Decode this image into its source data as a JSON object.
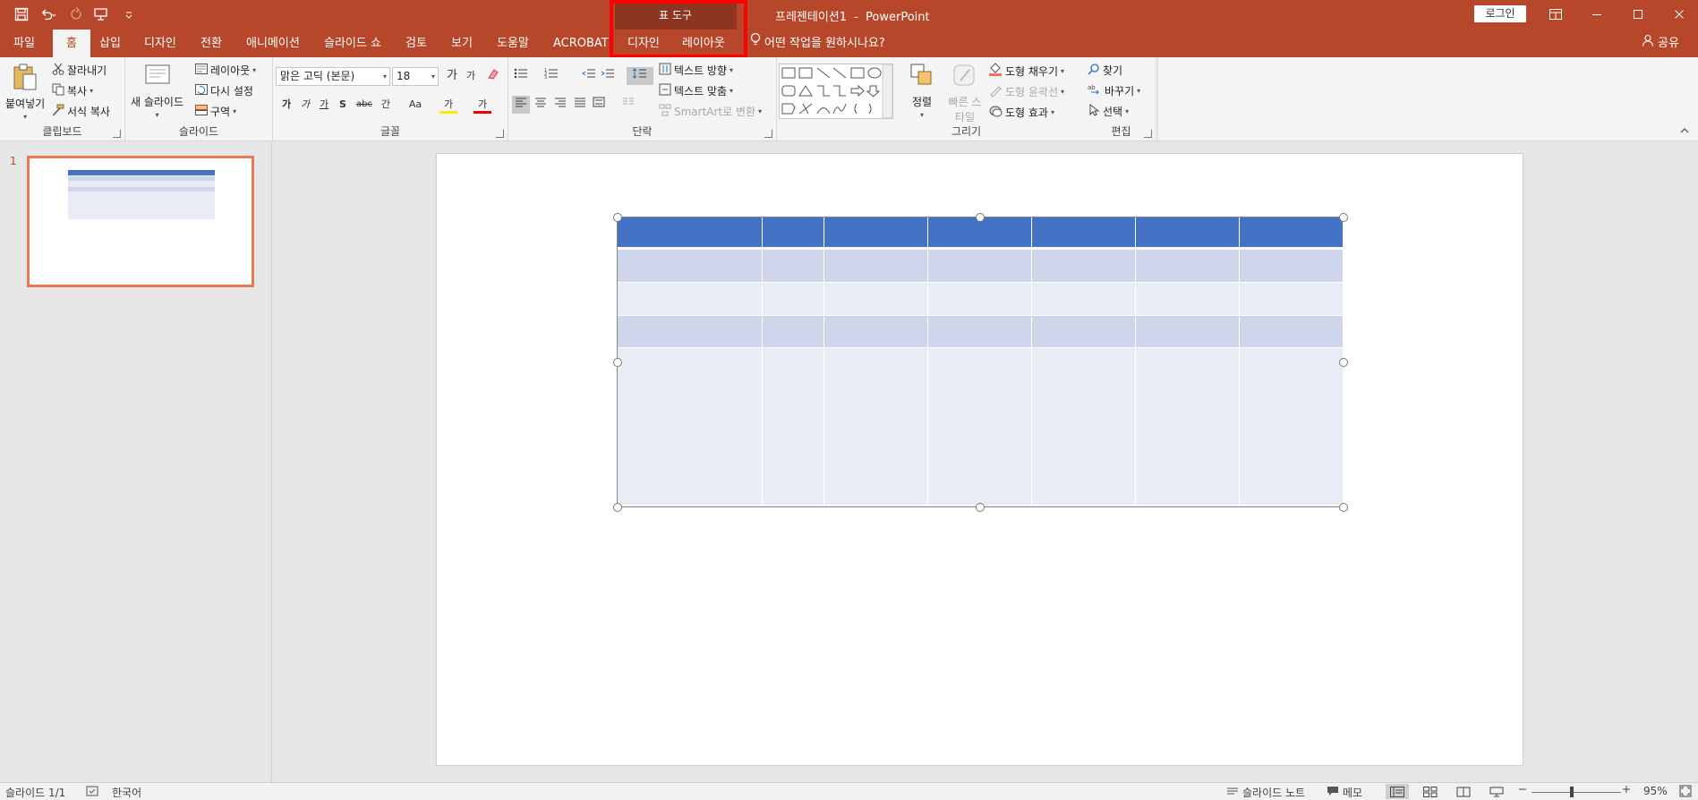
{
  "app": {
    "document_title": "프레젠테이션1",
    "separator": "-",
    "app_name": "PowerPoint",
    "login_label": "로그인",
    "context_group_label": "표 도구"
  },
  "tabs": [
    {
      "label": "파일"
    },
    {
      "label": "홈"
    },
    {
      "label": "삽입"
    },
    {
      "label": "디자인"
    },
    {
      "label": "전환"
    },
    {
      "label": "애니메이션"
    },
    {
      "label": "슬라이드 쇼"
    },
    {
      "label": "검토"
    },
    {
      "label": "보기"
    },
    {
      "label": "도움말"
    },
    {
      "label": "ACROBAT"
    },
    {
      "label": "디자인"
    },
    {
      "label": "레이아웃"
    }
  ],
  "active_tab_index": 1,
  "tellme": "어떤 작업을 원하시나요?",
  "share": "공유",
  "ribbon": {
    "clipboard": {
      "label": "클립보드",
      "paste": "붙여넣기",
      "cut": "잘라내기",
      "copy": "복사",
      "format_painter": "서식 복사"
    },
    "slides": {
      "label": "슬라이드",
      "new_slide": "새 슬라이드",
      "layout": "레이아웃",
      "reset": "다시 설정",
      "section": "구역"
    },
    "font": {
      "label": "글꼴",
      "font_name": "맑은 고딕 (본문)",
      "font_size": "18",
      "grow": "가",
      "shrink": "가",
      "bold": "가",
      "italic": "가",
      "underline": "가",
      "shadow": "S",
      "strike": "abc",
      "spacing": "간",
      "case": "Aa",
      "highlight": "가",
      "color": "가"
    },
    "paragraph": {
      "label": "단락",
      "text_direction": "텍스트 방향",
      "align_text": "텍스트 맞춤",
      "smartart": "SmartArt로 변환"
    },
    "drawing": {
      "label": "그리기",
      "arrange": "정렬",
      "quick_styles": "빠른 스타일",
      "fill": "도형 채우기",
      "outline": "도형 윤곽선",
      "effects": "도형 효과"
    },
    "editing": {
      "label": "편집",
      "find": "찾기",
      "replace": "바꾸기",
      "select": "선택"
    }
  },
  "slide_panel": {
    "slide_number": "1"
  },
  "table": {
    "header_color": "#4472c4",
    "band_color": "#cfd5ea",
    "light_color": "#e9ebf5",
    "column_weights": [
      133,
      57,
      95,
      95,
      95,
      95,
      95
    ],
    "row_weights": [
      30,
      31,
      31,
      30,
      146
    ]
  },
  "statusbar": {
    "slide_info": "슬라이드 1/1",
    "language": "한국어",
    "notes": "슬라이드 노트",
    "comments": "메모",
    "zoom": "95%"
  },
  "colors": {
    "accent": "#b7472a",
    "context_band": "#8e3520",
    "highlight_box": "#ff0000"
  }
}
